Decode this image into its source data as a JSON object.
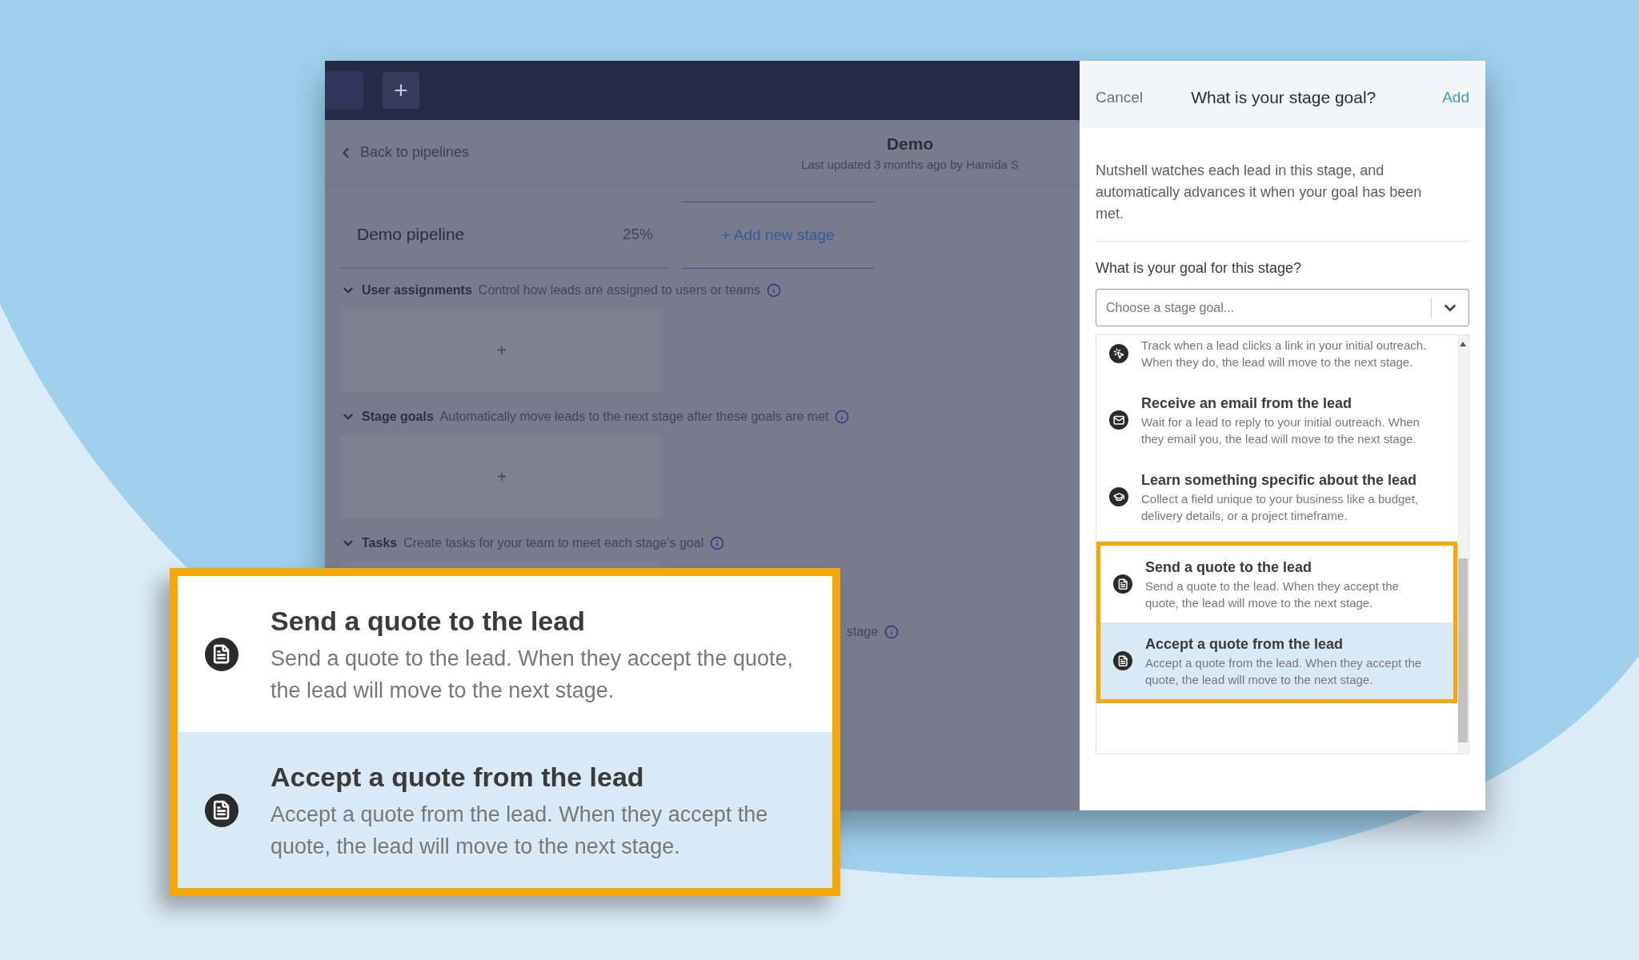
{
  "top_bar": {
    "add_label": "+"
  },
  "pipeline_header": {
    "back_link": "Back to pipelines",
    "title": "Demo",
    "subtitle": "Last updated 3 months ago by Hamida S"
  },
  "stage_row": {
    "name": "Demo pipeline",
    "percent": "25%",
    "add_stage": "+ Add new stage"
  },
  "sections": [
    {
      "title": "User assignments",
      "description": "Control how leads are assigned to users or teams",
      "add_label": "+"
    },
    {
      "title": "Stage goals",
      "description": "Automatically move leads to the next stage after these goals are met",
      "add_label": "+"
    },
    {
      "title": "Tasks",
      "description": "Create tasks for your team to meet each stage’s goal"
    }
  ],
  "covered_section": {
    "description": "stage"
  },
  "dialog": {
    "cancel": "Cancel",
    "title": "What is your stage goal?",
    "add": "Add",
    "intro": "Nutshell watches each lead in this stage, and automatically advances it when your goal has been met.",
    "question": "What is your goal for this stage?",
    "select": {
      "placeholder": "Choose a stage goal..."
    },
    "options": [
      {
        "kind": "click",
        "description": "Track when a lead clicks a link in your initial outreach. When they do, the lead will move to the next stage.",
        "selected": false
      },
      {
        "kind": "email",
        "title": "Receive an email from the lead",
        "description": "Wait for a lead to reply to your initial outreach. When they email you, the lead will move to the next stage.",
        "selected": false
      },
      {
        "kind": "learn",
        "title": "Learn something specific about the lead",
        "description": "Collect a field unique to your business like a budget, delivery details, or a project timeframe.",
        "selected": false
      },
      {
        "kind": "quote",
        "title": "Send a quote to the lead",
        "description": "Send a quote to the lead. When they accept the quote, the lead will move to the next stage.",
        "selected": false
      },
      {
        "kind": "quote",
        "title": "Accept a quote from the lead",
        "description": "Accept a quote from the lead. When they accept the quote, the lead will move to the next stage.",
        "selected": true
      }
    ]
  },
  "callout": {
    "items": [
      {
        "kind": "quote",
        "title": "Send a quote to the lead",
        "description": "Send a quote to the lead. When they accept the quote, the lead will move to the next stage.",
        "selected": false
      },
      {
        "kind": "quote",
        "title": "Accept a quote from the lead",
        "description": "Accept a quote from the lead. When they accept the quote, the lead will move to the next stage.",
        "selected": true
      }
    ]
  }
}
